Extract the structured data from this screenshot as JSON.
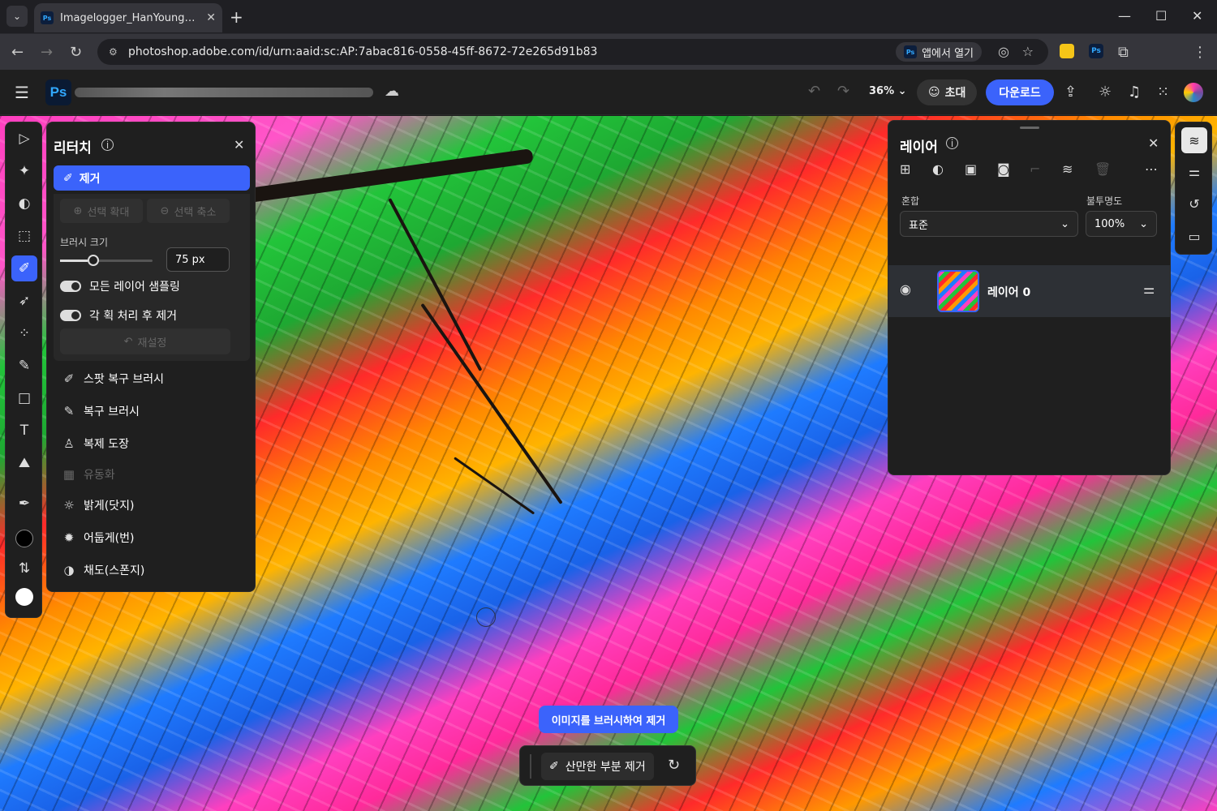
{
  "browser": {
    "tab_title": "Imagelogger_HanYoungDae_N",
    "favicon_text": "Ps",
    "url": "photoshop.adobe.com/id/urn:aaid:sc:AP:7abac816-0558-45ff-8672-72e265d91b83",
    "open_in_app": "앱에서 열기"
  },
  "app": {
    "logo": "Ps",
    "zoom": "36%",
    "invite_label": "초대",
    "download_label": "다운로드"
  },
  "retouch_panel": {
    "title": "리터치",
    "remove_label": "제거",
    "expand_selection": "선택 확대",
    "shrink_selection": "선택 축소",
    "brush_size_label": "브러시 크기",
    "brush_size_value": "75 px",
    "brush_size_level": 0.3,
    "sample_all_layers": "모든 레이어 샘플링",
    "remove_after_each_stroke": "각 획 처리 후 제거",
    "reset_label": "재설정",
    "tools": [
      {
        "label": "스팟 복구 브러시",
        "icon": "bandage-icon",
        "disabled": false
      },
      {
        "label": "복구 브러시",
        "icon": "bandage-icon",
        "disabled": false
      },
      {
        "label": "복제 도장",
        "icon": "stamp-icon",
        "disabled": false
      },
      {
        "label": "유동화",
        "icon": "liquify-icon",
        "disabled": true
      },
      {
        "label": "밝게(닷지)",
        "icon": "sun-icon",
        "disabled": false
      },
      {
        "label": "어둡게(번)",
        "icon": "sun-icon",
        "disabled": false
      },
      {
        "label": "채도(스폰지)",
        "icon": "sponge-icon",
        "disabled": false
      }
    ]
  },
  "layers_panel": {
    "title": "레이어",
    "blend_label": "혼합",
    "blend_value": "표준",
    "opacity_label": "불투명도",
    "opacity_value": "100%",
    "layer_name": "레이어 0"
  },
  "canvas": {
    "hint": "이미지를 브러시하여 제거",
    "distraction_removal": "산만한 부분 제거"
  },
  "colors": {
    "accent": "#3b63fb",
    "foreground_swatch": "#000000",
    "background_swatch": "#ffffff"
  }
}
